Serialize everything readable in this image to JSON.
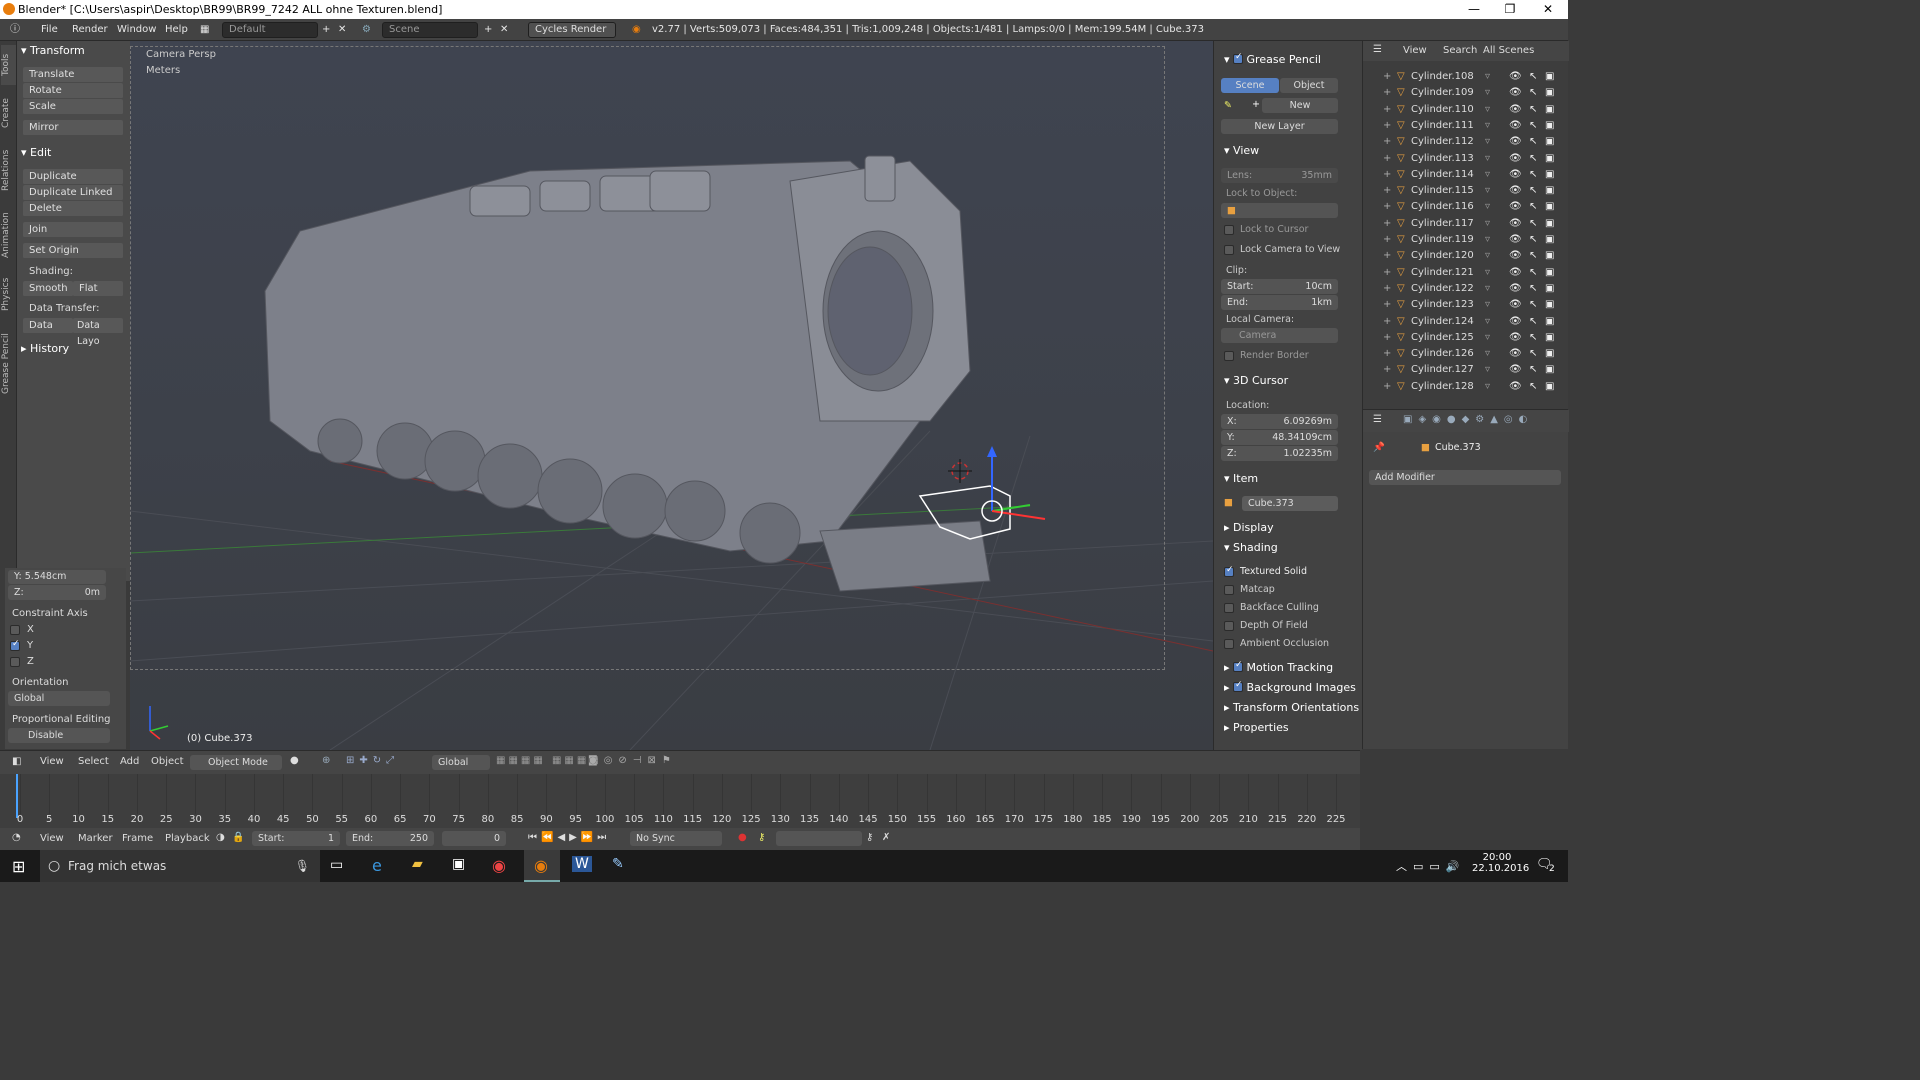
{
  "window": {
    "title": "Blender* [C:\\Users\\aspir\\Desktop\\BR99\\BR99_7242 ALL ohne Texturen.blend]",
    "controls": [
      "—",
      "❐",
      "✕"
    ]
  },
  "topbar": {
    "menus": [
      "File",
      "Render",
      "Window",
      "Help"
    ],
    "layout": "Default",
    "scene": "Scene",
    "engine": "Cycles Render",
    "stats": "v2.77 | Verts:509,073 | Faces:484,351 | Tris:1,009,248 | Objects:1/481 | Lamps:0/0 | Mem:199.54M | Cube.373"
  },
  "left_tabs": [
    "Tools",
    "Create",
    "Relations",
    "Animation",
    "Physics",
    "Grease Pencil"
  ],
  "toolshelf": {
    "transform": {
      "title": "Transform",
      "buttons": [
        "Translate",
        "Rotate",
        "Scale",
        "Mirror"
      ]
    },
    "edit": {
      "title": "Edit",
      "buttons": [
        "Duplicate",
        "Duplicate Linked",
        "Delete",
        "Join",
        "Set Origin"
      ]
    },
    "shading": {
      "title": "Shading:",
      "smooth": "Smooth",
      "flat": "Flat"
    },
    "data_transfer": {
      "title": "Data Transfer:",
      "data": "Data",
      "data_layout": "Data Layo"
    },
    "history": {
      "title": "History"
    }
  },
  "operator_panel": {
    "y_value": "Y:      5.548cm",
    "z_label": "Z:",
    "z_value": "0m",
    "constraint_axis": "Constraint Axis",
    "axes": [
      {
        "label": "X",
        "checked": false
      },
      {
        "label": "Y",
        "checked": true
      },
      {
        "label": "Z",
        "checked": false
      }
    ],
    "orientation_label": "Orientation",
    "orientation_value": "Global",
    "prop_edit_label": "Proportional Editing",
    "prop_edit_value": "Disable"
  },
  "viewport": {
    "view_name": "Camera Persp",
    "units": "Meters",
    "object_label": "(0) Cube.373"
  },
  "properties_panel": {
    "grease_pencil": {
      "title": "Grease Pencil",
      "scene_tab": "Scene",
      "object_tab": "Object",
      "new": "New",
      "new_layer": "New Layer"
    },
    "view": {
      "title": "View",
      "lens_label": "Lens:",
      "lens_value": "35mm",
      "lock_to_object": "Lock to Object:",
      "lock_to_cursor": "Lock to Cursor",
      "lock_camera": "Lock Camera to View",
      "clip_label": "Clip:",
      "start_label": "Start:",
      "start_value": "10cm",
      "end_label": "End:",
      "end_value": "1km",
      "local_camera": "Local Camera:",
      "camera_value": "Camera",
      "render_border": "Render Border"
    },
    "cursor": {
      "title": "3D Cursor",
      "location": "Location:",
      "x_label": "X:",
      "x_value": "6.09269m",
      "y_label": "Y:",
      "y_value": "48.34109cm",
      "z_label": "Z:",
      "z_value": "1.02235m"
    },
    "item": {
      "title": "Item",
      "name": "Cube.373"
    },
    "display": {
      "title": "Display"
    },
    "shading": {
      "title": "Shading",
      "options": [
        {
          "label": "Textured Solid",
          "checked": true
        },
        {
          "label": "Matcap",
          "checked": false
        },
        {
          "label": "Backface Culling",
          "checked": false
        },
        {
          "label": "Depth Of Field",
          "checked": false
        },
        {
          "label": "Ambient Occlusion",
          "checked": false
        }
      ]
    },
    "motion_tracking": "Motion Tracking",
    "background_images": "Background Images",
    "transform_orientations": "Transform Orientations",
    "properties": "Properties"
  },
  "outliner": {
    "menus": [
      "View",
      "Search",
      "All Scenes"
    ],
    "items": [
      "Cylinder.108",
      "Cylinder.109",
      "Cylinder.110",
      "Cylinder.111",
      "Cylinder.112",
      "Cylinder.113",
      "Cylinder.114",
      "Cylinder.115",
      "Cylinder.116",
      "Cylinder.117",
      "Cylinder.119",
      "Cylinder.120",
      "Cylinder.121",
      "Cylinder.122",
      "Cylinder.123",
      "Cylinder.124",
      "Cylinder.125",
      "Cylinder.126",
      "Cylinder.127",
      "Cylinder.128"
    ]
  },
  "props_editor": {
    "object": "Cube.373",
    "add_modifier": "Add Modifier"
  },
  "view3d_header": {
    "menus": [
      "View",
      "Select",
      "Add",
      "Object"
    ],
    "mode": "Object Mode",
    "orientation": "Global"
  },
  "timeline": {
    "ticks": [
      "0",
      "5",
      "10",
      "15",
      "20",
      "25",
      "30",
      "35",
      "40",
      "45",
      "50",
      "55",
      "60",
      "65",
      "70",
      "75",
      "80",
      "85",
      "90",
      "95",
      "100",
      "105",
      "110",
      "115",
      "120",
      "125",
      "130",
      "135",
      "140",
      "145",
      "150",
      "155",
      "160",
      "165",
      "170",
      "175",
      "180",
      "185",
      "190",
      "195",
      "200",
      "205",
      "210",
      "215",
      "220",
      "225"
    ],
    "menus": [
      "View",
      "Marker",
      "Frame",
      "Playback"
    ],
    "start_label": "Start:",
    "start_value": "1",
    "end_label": "End:",
    "end_value": "250",
    "current": "0",
    "sync": "No Sync"
  },
  "taskbar": {
    "search": "Frag mich etwas",
    "time": "20:00",
    "date": "22.10.2016",
    "notifications": "2"
  },
  "colors": {
    "accent": "#5680c2",
    "selection": "#ffffff",
    "axis_x": "#ff3333",
    "axis_y": "#33cc33",
    "axis_z": "#3366ff"
  }
}
